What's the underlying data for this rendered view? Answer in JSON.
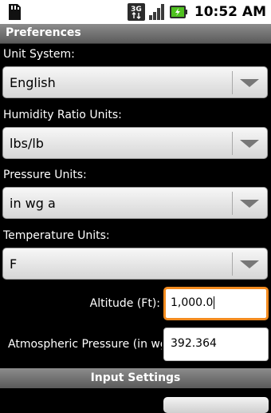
{
  "status_bar": {
    "time": "10:52 AM",
    "network_label": "3G",
    "icons": [
      "sd-card-icon",
      "network-3g-icon",
      "signal-bars-icon",
      "battery-charging-icon"
    ]
  },
  "title": "Preferences",
  "unit_system": {
    "label": "Unit System:",
    "value": "English"
  },
  "humidity_ratio": {
    "label": "Humidity Ratio Units:",
    "value": "lbs/lb"
  },
  "pressure": {
    "label": "Pressure Units:",
    "value": "in wg a"
  },
  "temperature": {
    "label": "Temperature Units:",
    "value": "F"
  },
  "altitude": {
    "label": "Altitude (Ft):",
    "value": "1,000.0"
  },
  "atmospheric_pressure": {
    "label": "Atmospheric Pressure (in wg",
    "value": "392.364"
  },
  "section": {
    "input_settings": "Input Settings"
  },
  "colors": {
    "focus_accent": "#f28b1f",
    "battery_green": "#4fc11f"
  }
}
